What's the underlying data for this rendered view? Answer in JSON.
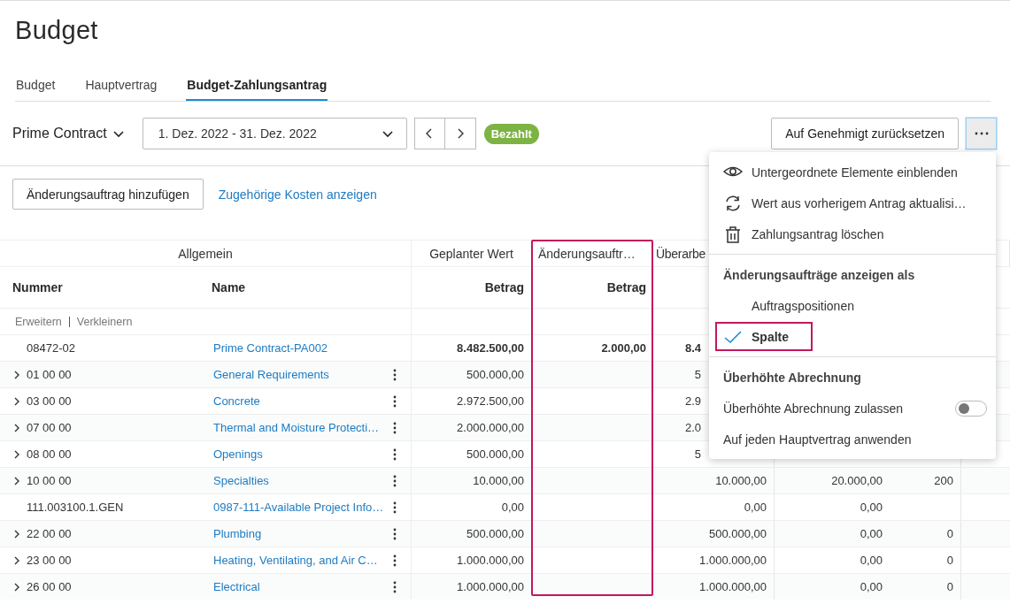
{
  "page_title": "Budget",
  "tabs": [
    {
      "label": "Budget",
      "selected": false
    },
    {
      "label": "Hauptvertrag",
      "selected": false
    },
    {
      "label": "Budget-Zahlungsantrag",
      "selected": true
    }
  ],
  "toolbar": {
    "contract_selector": "Prime Contract",
    "period": "1. Dez. 2022 - 31. Dez. 2022",
    "status_badge": "Bezahlt",
    "reset_button": "Auf Genehmigt zurücksetzen",
    "more_button": {
      "expanded": true
    }
  },
  "actions": {
    "add_button": "Änderungsauftrag hinzufügen",
    "link": "Zugehörige Kosten anzeigen"
  },
  "table": {
    "column_groups": [
      "Allgemein",
      "Geplanter Wert",
      "Änderungsauftr…",
      "Überarbe"
    ],
    "columns": [
      {
        "label": "Nummer",
        "highlighted": false
      },
      {
        "label": "Name",
        "highlighted": false
      },
      {
        "label": "Betrag",
        "highlighted": false
      },
      {
        "label": "Betrag",
        "highlighted": true
      }
    ],
    "expand_links": [
      "Erweitern",
      "Verkleinern"
    ],
    "rows": [
      {
        "number": "08472-02",
        "name": "Prime Contract-PA002",
        "total": true,
        "expandable": false,
        "covered": true,
        "cells": {
          "geplanter_wert": "8.482.500,00",
          "aenderungsauftraege": "2.000,00",
          "ueberarbeitet": "8.4"
        }
      },
      {
        "number": "01 00 00",
        "name": "General Requirements",
        "total": false,
        "expandable": true,
        "covered": true,
        "cells": {
          "geplanter_wert": "500.000,00",
          "ueberarbeitet": "5"
        }
      },
      {
        "number": "03 00 00",
        "name": "Concrete",
        "total": false,
        "expandable": true,
        "covered": true,
        "cells": {
          "geplanter_wert": "2.972.500,00",
          "ueberarbeitet": "2.9"
        }
      },
      {
        "number": "07 00 00",
        "name": "Thermal and Moisture Protecti…",
        "total": false,
        "expandable": true,
        "covered": true,
        "cells": {
          "geplanter_wert": "2.000.000,00",
          "ueberarbeitet": "2.0"
        }
      },
      {
        "number": "08 00 00",
        "name": "Openings",
        "total": false,
        "expandable": true,
        "covered": true,
        "cells": {
          "geplanter_wert": "500.000,00",
          "ueberarbeitet": "5"
        }
      },
      {
        "number": "10 00 00",
        "name": "Specialties",
        "total": false,
        "expandable": true,
        "covered": false,
        "cells": {
          "geplanter_wert": "10.000,00",
          "ueberarbeitet": "10.000,00",
          "column_6": "20.000,00",
          "column_7": "200"
        }
      },
      {
        "number": "111.003100.1.GEN",
        "name": "0987-111-Available Project Info…",
        "total": false,
        "expandable": false,
        "covered": false,
        "cells": {
          "geplanter_wert": "0,00",
          "ueberarbeitet": "0,00",
          "column_6": "0,00"
        }
      },
      {
        "number": "22 00 00",
        "name": "Plumbing",
        "total": false,
        "expandable": true,
        "covered": false,
        "cells": {
          "geplanter_wert": "500.000,00",
          "ueberarbeitet": "500.000,00",
          "column_6": "0,00",
          "column_7": "0"
        }
      },
      {
        "number": "23 00 00",
        "name": "Heating, Ventilating, and Air C…",
        "total": false,
        "expandable": true,
        "covered": false,
        "cells": {
          "geplanter_wert": "1.000.000,00",
          "ueberarbeitet": "1.000.000,00",
          "column_6": "0,00",
          "column_7": "0"
        }
      },
      {
        "number": "26 00 00",
        "name": "Electrical",
        "total": false,
        "expandable": true,
        "covered": false,
        "cells": {
          "geplanter_wert": "1.000.000,00",
          "ueberarbeitet": "1.000.000,00",
          "column_6": "0,00",
          "column_7": "0"
        }
      }
    ]
  },
  "menu": {
    "groups": [
      {
        "items": [
          {
            "kind": "action",
            "label": "Untergeordnete Elemente einblenden"
          },
          {
            "kind": "action",
            "label": "Wert aus vorherigem Antrag aktualisi…"
          },
          {
            "kind": "action",
            "label": "Zahlungsantrag löschen"
          }
        ]
      },
      {
        "items": [
          {
            "kind": "header",
            "label": "Änderungsaufträge anzeigen als"
          },
          {
            "kind": "option",
            "label": "Auftragspositionen",
            "selected": false,
            "highlighted": false
          },
          {
            "kind": "option",
            "label": "Spalte",
            "selected": true,
            "highlighted": true
          }
        ]
      },
      {
        "items": [
          {
            "kind": "header",
            "label": "Überhöhte Abrechnung"
          },
          {
            "kind": "toggle",
            "label": "Überhöhte Abrechnung zulassen",
            "on": false
          },
          {
            "kind": "text",
            "label": "Auf jeden Hauptvertrag anwenden"
          }
        ]
      }
    ]
  }
}
